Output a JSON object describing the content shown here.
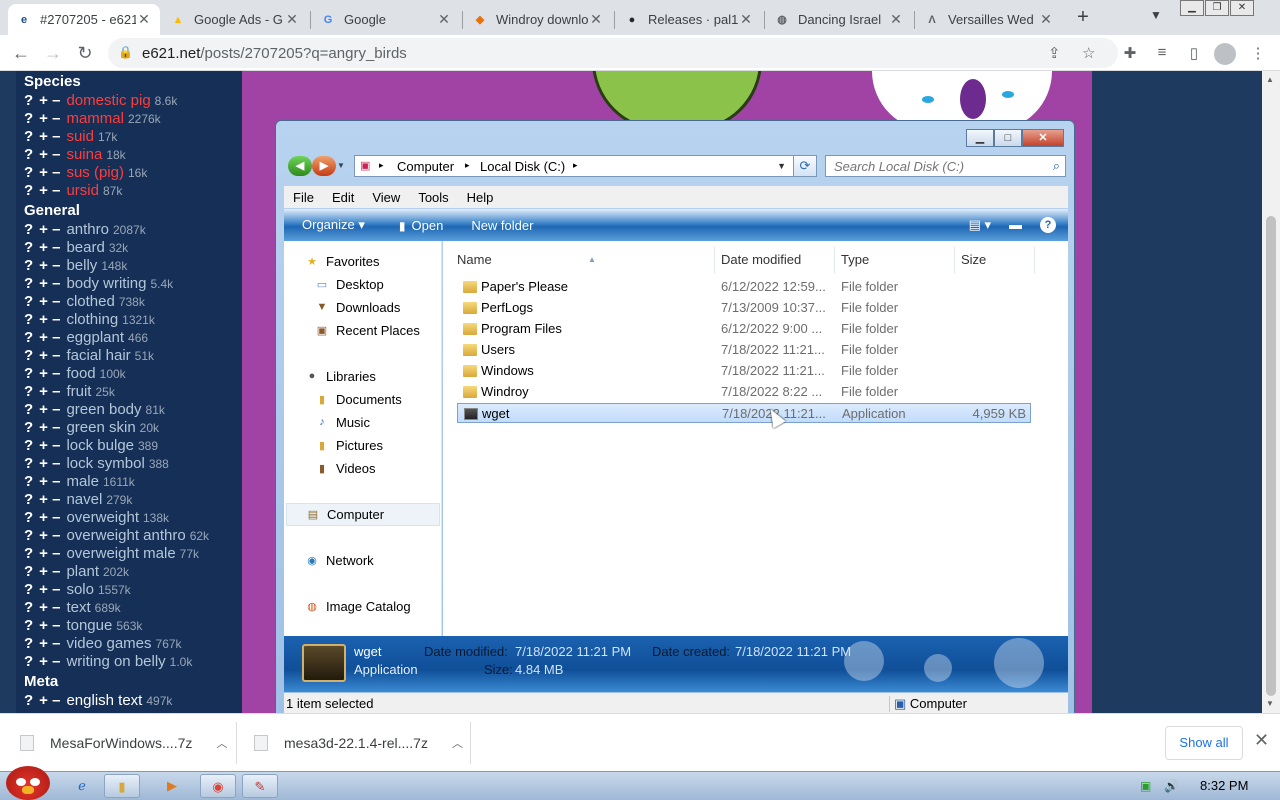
{
  "browser": {
    "tabs": [
      {
        "title": "#2707205 - e621",
        "favicon": "e621-icon"
      },
      {
        "title": "Google Ads - G",
        "favicon": "google-ads-icon"
      },
      {
        "title": "Google",
        "favicon": "google-icon"
      },
      {
        "title": "Windroy download",
        "favicon": "windroy-icon"
      },
      {
        "title": "Releases · pal1",
        "favicon": "github-icon"
      },
      {
        "title": "Dancing Israel",
        "favicon": "globe-icon"
      },
      {
        "title": "Versailles Wed",
        "favicon": "versailles-icon"
      }
    ],
    "url": {
      "host": "e621.net",
      "path": "/posts/2707205?q=angry_birds"
    }
  },
  "sidebar": {
    "categories": [
      {
        "title": "Species",
        "color": "red",
        "tags": [
          {
            "name": "domestic pig",
            "count": "8.6k"
          },
          {
            "name": "mammal",
            "count": "2276k"
          },
          {
            "name": "suid",
            "count": "17k"
          },
          {
            "name": "suina",
            "count": "18k"
          },
          {
            "name": "sus (pig)",
            "count": "16k"
          },
          {
            "name": "ursid",
            "count": "87k"
          }
        ]
      },
      {
        "title": "General",
        "color": "blue",
        "tags": [
          {
            "name": "anthro",
            "count": "2087k"
          },
          {
            "name": "beard",
            "count": "32k"
          },
          {
            "name": "belly",
            "count": "148k"
          },
          {
            "name": "body writing",
            "count": "5.4k"
          },
          {
            "name": "clothed",
            "count": "738k"
          },
          {
            "name": "clothing",
            "count": "1321k"
          },
          {
            "name": "eggplant",
            "count": "466"
          },
          {
            "name": "facial hair",
            "count": "51k"
          },
          {
            "name": "food",
            "count": "100k"
          },
          {
            "name": "fruit",
            "count": "25k"
          },
          {
            "name": "green body",
            "count": "81k"
          },
          {
            "name": "green skin",
            "count": "20k"
          },
          {
            "name": "lock bulge",
            "count": "389"
          },
          {
            "name": "lock symbol",
            "count": "388"
          },
          {
            "name": "male",
            "count": "1611k"
          },
          {
            "name": "navel",
            "count": "279k"
          },
          {
            "name": "overweight",
            "count": "138k"
          },
          {
            "name": "overweight anthro",
            "count": "62k"
          },
          {
            "name": "overweight male",
            "count": "77k"
          },
          {
            "name": "plant",
            "count": "202k"
          },
          {
            "name": "solo",
            "count": "1557k"
          },
          {
            "name": "text",
            "count": "689k"
          },
          {
            "name": "tongue",
            "count": "563k"
          },
          {
            "name": "video games",
            "count": "767k"
          },
          {
            "name": "writing on belly",
            "count": "1.0k"
          }
        ]
      },
      {
        "title": "Meta",
        "color": "white",
        "tags": [
          {
            "name": "english text",
            "count": "497k"
          }
        ]
      }
    ],
    "tag_q": "?",
    "tag_pm": "+ –"
  },
  "explorer": {
    "breadcrumb": [
      "Computer",
      "Local Disk (C:)"
    ],
    "search_placeholder": "Search Local Disk (C:)",
    "menu": [
      "File",
      "Edit",
      "View",
      "Tools",
      "Help"
    ],
    "commands": {
      "organize": "Organize ▾",
      "open": "Open",
      "new_folder": "New folder"
    },
    "nav": {
      "favorites": "Favorites",
      "favorites_items": [
        "Desktop",
        "Downloads",
        "Recent Places"
      ],
      "libraries": "Libraries",
      "libraries_items": [
        "Documents",
        "Music",
        "Pictures",
        "Videos"
      ],
      "computer": "Computer",
      "network": "Network",
      "image_catalog": "Image Catalog"
    },
    "columns": {
      "name": "Name",
      "date": "Date modified",
      "type": "Type",
      "size": "Size"
    },
    "files": [
      {
        "name": "Paper's Please",
        "date": "6/12/2022 12:59...",
        "type": "File folder",
        "size": "",
        "icon": "folder"
      },
      {
        "name": "PerfLogs",
        "date": "7/13/2009 10:37...",
        "type": "File folder",
        "size": "",
        "icon": "folder"
      },
      {
        "name": "Program Files",
        "date": "6/12/2022 9:00 ...",
        "type": "File folder",
        "size": "",
        "icon": "folder"
      },
      {
        "name": "Users",
        "date": "7/18/2022 11:21...",
        "type": "File folder",
        "size": "",
        "icon": "folder"
      },
      {
        "name": "Windows",
        "date": "7/18/2022 11:21...",
        "type": "File folder",
        "size": "",
        "icon": "folder"
      },
      {
        "name": "Windroy",
        "date": "7/18/2022 8:22 ...",
        "type": "File folder",
        "size": "",
        "icon": "folder"
      },
      {
        "name": "wget",
        "date": "7/18/2022 11:21...",
        "type": "Application",
        "size": "4,959 KB",
        "icon": "app",
        "selected": true
      }
    ],
    "details": {
      "name": "wget",
      "kind": "Application",
      "date_modified_label": "Date modified:",
      "date_modified": "7/18/2022 11:21 PM",
      "date_created_label": "Date created:",
      "date_created": "7/18/2022 11:21 PM",
      "size_label": "Size:",
      "size": "4.84 MB"
    },
    "status": {
      "left": "1 item selected",
      "right": "Computer"
    }
  },
  "downloads": {
    "items": [
      "MesaForWindows....7z",
      "mesa3d-22.1.4-rel....7z"
    ],
    "show_all": "Show all"
  },
  "taskbar": {
    "time": "8:32 PM"
  }
}
